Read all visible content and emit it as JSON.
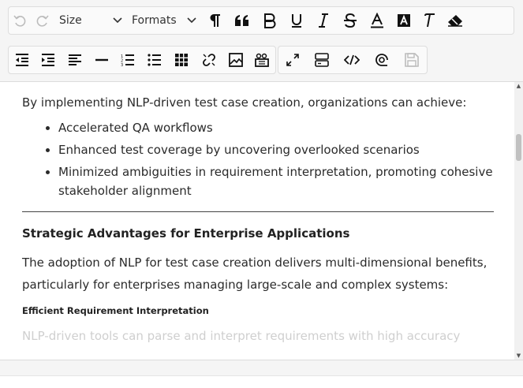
{
  "toolbar": {
    "size_label": "Size",
    "formats_label": "Formats",
    "icons_row1": [
      "undo-icon",
      "redo-icon",
      "paragraph-icon",
      "blockquote-icon",
      "bold-icon",
      "underline-icon",
      "italic-icon",
      "strikethrough-icon",
      "font-color-icon",
      "highlight-color-icon",
      "clear-formatting-icon",
      "eraser-icon"
    ],
    "icons_row2": [
      "outdent-icon",
      "indent-icon",
      "align-icon",
      "horizontal-rule-icon",
      "ordered-list-icon",
      "unordered-list-icon",
      "table-icon",
      "link-icon",
      "image-icon",
      "video-icon",
      "fullscreen-icon",
      "show-blocks-icon",
      "code-view-icon",
      "preview-icon",
      "save-icon"
    ]
  },
  "content": {
    "intro": "By implementing NLP-driven test case creation, organizations can achieve:",
    "bullets": [
      "Accelerated QA workflows",
      "Enhanced test coverage by uncovering overlooked scenarios",
      "Minimized ambiguities in requirement interpretation, promoting cohesive stakeholder alignment"
    ],
    "section_heading": "Strategic Advantages for Enterprise Applications",
    "section_body": "The adoption of NLP for test case creation delivers multi-dimensional benefits, particularly for enterprises managing large-scale and complex systems:",
    "subheading": "Efficient Requirement Interpretation",
    "cut_line": "NLP-driven tools can parse and interpret requirements with high accuracy"
  },
  "colors": {
    "toolbar_bg": "#f5f5f5",
    "text": "#2a2a2a",
    "disabled": "#bcbcbc"
  }
}
